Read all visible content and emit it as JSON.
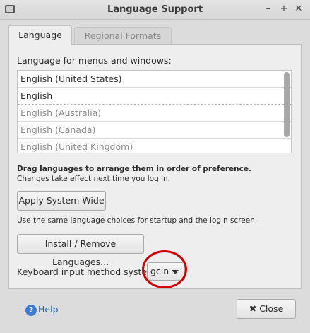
{
  "window": {
    "title": "Language Support",
    "controls": {
      "minimize": "–",
      "maximize": "+",
      "close": "✕"
    }
  },
  "tabs": [
    {
      "label": "Language",
      "active": true
    },
    {
      "label": "Regional Formats",
      "active": false
    }
  ],
  "language_section": {
    "heading": "Language for menus and windows:",
    "languages": [
      "English (United States)",
      "English",
      "English (Australia)",
      "English (Canada)",
      "English (United Kingdom)"
    ],
    "drag_hint_bold": "Drag languages to arrange them in order of preference.",
    "drag_hint_sub": "Changes take effect next time you log in."
  },
  "buttons": {
    "apply_system_wide": "Apply System-Wide",
    "install_remove": "Install / Remove Languages...",
    "help": "Help",
    "close": "Close"
  },
  "system_note": "Use the same language choices for startup and the login screen.",
  "keyboard": {
    "label": "Keyboard input method system:",
    "selected": "gcin"
  },
  "colors": {
    "annotation_circle": "#d40000",
    "help_link": "#2a5fb0"
  }
}
